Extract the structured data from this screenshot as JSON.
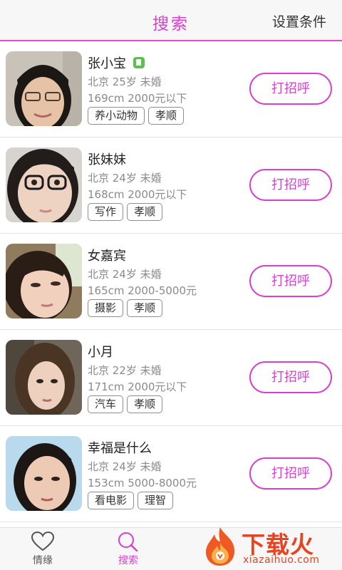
{
  "header": {
    "title": "搜索",
    "settings_label": "设置条件"
  },
  "greet_label": "打招呼",
  "users": [
    {
      "name": "张小宝",
      "verified": true,
      "info": "北京 25岁 未婚",
      "detail": "169cm 2000元以下",
      "tags": [
        "养小动物",
        "孝顺"
      ]
    },
    {
      "name": "张妹妹",
      "verified": false,
      "info": "北京 24岁 未婚",
      "detail": "168cm 2000元以下",
      "tags": [
        "写作",
        "孝顺"
      ]
    },
    {
      "name": "女嘉宾",
      "verified": false,
      "info": "北京 24岁 未婚",
      "detail": "165cm 2000-5000元",
      "tags": [
        "摄影",
        "孝顺"
      ]
    },
    {
      "name": "小月",
      "verified": false,
      "info": "北京 22岁 未婚",
      "detail": "171cm 2000元以下",
      "tags": [
        "汽车",
        "孝顺"
      ]
    },
    {
      "name": "幸福是什么",
      "verified": false,
      "info": "北京 24岁 未婚",
      "detail": "153cm 5000-8000元",
      "tags": [
        "看电影",
        "理智"
      ]
    }
  ],
  "tabbar": {
    "items": [
      {
        "label": "情缘",
        "icon": "heart-icon"
      },
      {
        "label": "搜索",
        "icon": "search-icon"
      }
    ]
  },
  "brand": {
    "cn": "下载火",
    "domain": "xiazaihuo.com"
  },
  "colors": {
    "accent": "#d83ed2",
    "brand": "#e8421f",
    "verified": "#5cbf4f"
  }
}
